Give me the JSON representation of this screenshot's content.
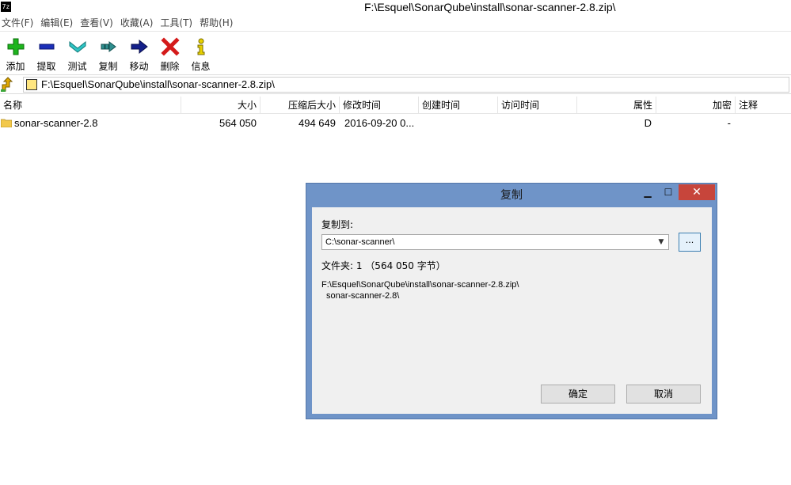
{
  "app": {
    "icon_text": "7z",
    "title": "F:\\Esquel\\SonarQube\\install\\sonar-scanner-2.8.zip\\"
  },
  "menu": [
    "文件(F)",
    "编辑(E)",
    "查看(V)",
    "收藏(A)",
    "工具(T)",
    "帮助(H)"
  ],
  "toolbar": [
    {
      "label": "添加",
      "icon": "add-icon"
    },
    {
      "label": "提取",
      "icon": "extract-icon"
    },
    {
      "label": "测试",
      "icon": "test-icon"
    },
    {
      "label": "复制",
      "icon": "copy-icon"
    },
    {
      "label": "移动",
      "icon": "move-icon"
    },
    {
      "label": "删除",
      "icon": "delete-icon"
    },
    {
      "label": "信息",
      "icon": "info-icon"
    }
  ],
  "address": {
    "path": "F:\\Esquel\\SonarQube\\install\\sonar-scanner-2.8.zip\\"
  },
  "columns": [
    "名称",
    "大小",
    "压缩后大小",
    "修改时间",
    "创建时间",
    "访问时间",
    "属性",
    "加密",
    "注释"
  ],
  "rows": [
    {
      "name": "sonar-scanner-2.8",
      "size": "564 050",
      "packed": "494 649",
      "modified": "2016-09-20 0...",
      "created": "",
      "accessed": "",
      "attr": "D",
      "encrypted": "-",
      "comment": ""
    }
  ],
  "dialog": {
    "title": "复制",
    "minimize": "▁",
    "maximize": "☐",
    "close": "✕",
    "copy_to_label": "复制到:",
    "destination": "C:\\sonar-scanner\\",
    "browse_label": "...",
    "summary": "文件夹:  1  （564 050 字节）",
    "source_line1": "F:\\Esquel\\SonarQube\\install\\sonar-scanner-2.8.zip\\",
    "source_line2": "sonar-scanner-2.8\\",
    "ok_label": "确定",
    "cancel_label": "取消"
  },
  "colors": {
    "dialog_frame": "#6f94c8",
    "close_button": "#c7453b"
  }
}
